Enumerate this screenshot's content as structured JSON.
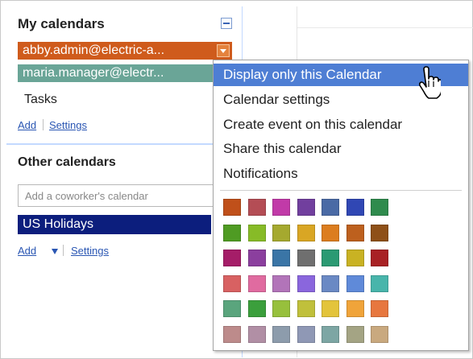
{
  "sidebar": {
    "my_calendars": {
      "title": "My calendars",
      "items": [
        {
          "label": "abby.admin@electric-a..."
        },
        {
          "label": "maria.manager@electr..."
        },
        {
          "label": "Tasks"
        }
      ],
      "add_link": "Add",
      "settings_link": "Settings"
    },
    "other_calendars": {
      "title": "Other calendars",
      "input_placeholder": "Add a coworker's calendar",
      "items": [
        {
          "label": "US Holidays"
        }
      ],
      "add_link": "Add",
      "settings_link": "Settings"
    }
  },
  "menu": {
    "items": [
      {
        "label": "Display only this Calendar"
      },
      {
        "label": "Calendar settings"
      },
      {
        "label": "Create event on this calendar"
      },
      {
        "label": "Share this calendar"
      },
      {
        "label": "Notifications"
      }
    ],
    "colors": [
      "#c0501a",
      "#b44d55",
      "#c13aa8",
      "#713f9e",
      "#4a6aa5",
      "#3047b4",
      "#2f8b4d",
      "#4f9b23",
      "#87bb27",
      "#a5a92f",
      "#d9a624",
      "#dc7d1f",
      "#bd601e",
      "#8e5018",
      "#a51d68",
      "#8b3f9e",
      "#3a75a6",
      "#6f6f6f",
      "#2b9a73",
      "#c9b223",
      "#a82124",
      "#d86162",
      "#e06ba0",
      "#b274b9",
      "#8a66dd",
      "#6a89c4",
      "#5f8ad9",
      "#48b5ab",
      "#5aa57d",
      "#3b9f3c",
      "#97c03c",
      "#c0c03b",
      "#e3c43b",
      "#f0a43a",
      "#e7773f",
      "#bd8b8b",
      "#b18fa5",
      "#8d9cac",
      "#8f98b5",
      "#7da6a4",
      "#a4a484",
      "#c9a97f"
    ]
  },
  "colors": {
    "accent": "#4e7ed4",
    "selected_calendar": "#cf5b1c",
    "second_calendar": "#6aa597",
    "holiday_calendar": "#0c1e7d",
    "link": "#2a56b3"
  }
}
